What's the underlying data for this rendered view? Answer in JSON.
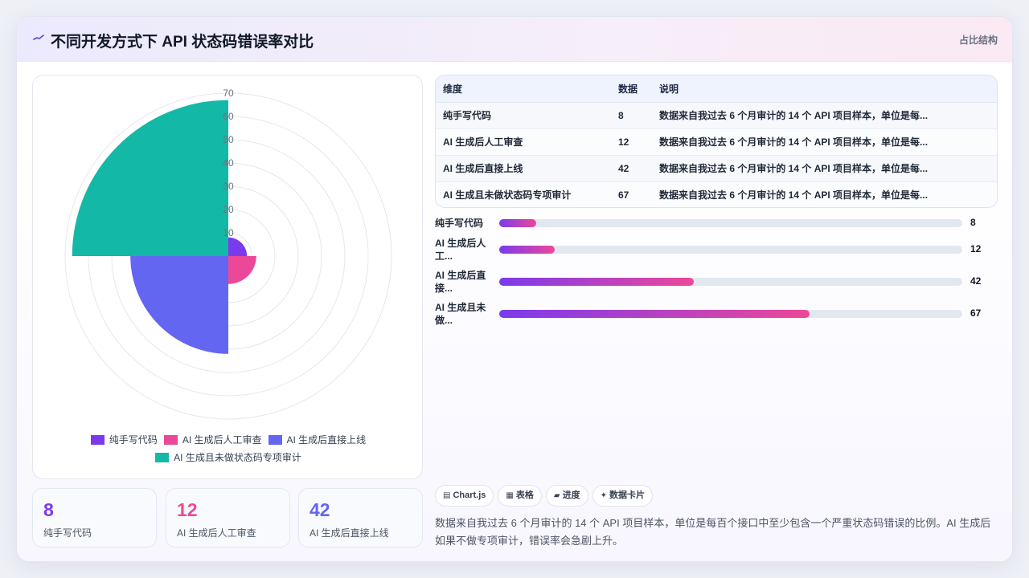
{
  "header": {
    "title": "不同开发方式下 API 状态码错误率对比",
    "tag": "占比结构",
    "icon": "sparkline-icon"
  },
  "colors": {
    "purple": "#7c3aed",
    "pink": "#ec4899",
    "indigo": "#6366f1",
    "teal": "#14b8a6"
  },
  "chart_data": {
    "type": "polarArea",
    "categories": [
      "纯手写代码",
      "AI 生成后人工审查",
      "AI 生成后直接上线",
      "AI 生成且未做状态码专项审计"
    ],
    "values": [
      8,
      12,
      42,
      67
    ],
    "colors": [
      "#7c3aed",
      "#ec4899",
      "#6366f1",
      "#14b8a6"
    ],
    "rlim": [
      0,
      70
    ],
    "ticks": [
      "10",
      "20",
      "30",
      "40",
      "50",
      "60",
      "70"
    ],
    "grid": true,
    "legend": "bottom"
  },
  "stats": [
    {
      "value": "8",
      "label": "纯手写代码",
      "color": "#7c3aed"
    },
    {
      "value": "12",
      "label": "AI 生成后人工审查",
      "color": "#ec4899"
    },
    {
      "value": "42",
      "label": "AI 生成后直接上线",
      "color": "#6366f1"
    }
  ],
  "table": {
    "headers": [
      "维度",
      "数据",
      "说明"
    ],
    "rows": [
      {
        "dim": "纯手写代码",
        "val": "8",
        "desc": "数据来自我过去 6 个月审计的 14 个 API 项目样本，单位是每..."
      },
      {
        "dim": "AI 生成后人工审查",
        "val": "12",
        "desc": "数据来自我过去 6 个月审计的 14 个 API 项目样本，单位是每..."
      },
      {
        "dim": "AI 生成后直接上线",
        "val": "42",
        "desc": "数据来自我过去 6 个月审计的 14 个 API 项目样本，单位是每..."
      },
      {
        "dim": "AI 生成且未做状态码专项审计",
        "val": "67",
        "desc": "数据来自我过去 6 个月审计的 14 个 API 项目样本，单位是每..."
      }
    ]
  },
  "progress": {
    "max": 100,
    "items": [
      {
        "label": "纯手写代码",
        "value": 8,
        "value_text": "8"
      },
      {
        "label": "AI 生成后人工...",
        "value": 12,
        "value_text": "12"
      },
      {
        "label": "AI 生成后直接...",
        "value": 42,
        "value_text": "42"
      },
      {
        "label": "AI 生成且未做...",
        "value": 67,
        "value_text": "67"
      }
    ]
  },
  "chips": [
    {
      "icon": "▤",
      "icon_name": "chart-icon",
      "label": "Chart.js"
    },
    {
      "icon": "▦",
      "icon_name": "table-icon",
      "label": "表格"
    },
    {
      "icon": "▰",
      "icon_name": "progress-icon",
      "label": "进度"
    },
    {
      "icon": "✦",
      "icon_name": "sparkle-icon",
      "label": "数据卡片"
    }
  ],
  "note": "数据来自我过去 6 个月审计的 14 个 API 项目样本，单位是每百个接口中至少包含一个严重状态码错误的比例。AI 生成后如果不做专项审计，错误率会急剧上升。"
}
